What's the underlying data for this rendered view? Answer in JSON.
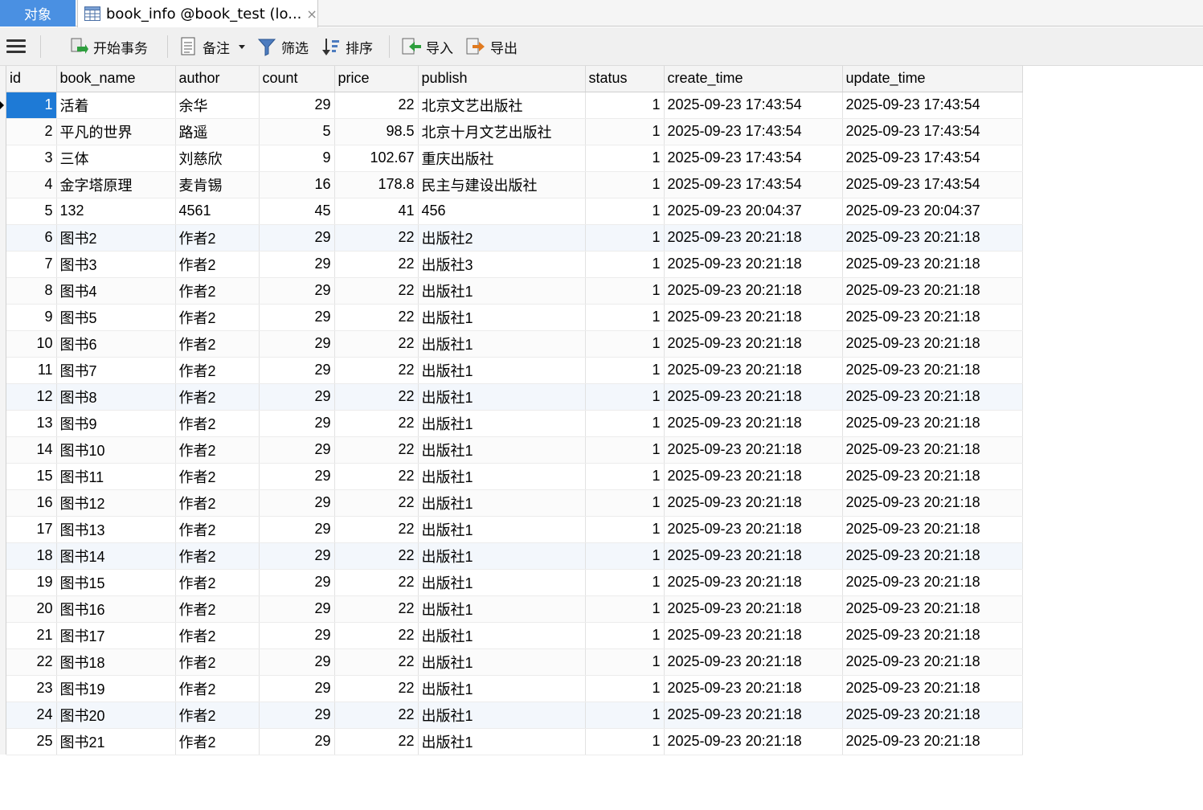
{
  "tabs": {
    "objects_label": "对象",
    "table_tab_label": "book_info @book_test (lo...",
    "close_glyph": "×"
  },
  "toolbar": {
    "begin_transaction": "开始事务",
    "notes": "备注",
    "filter": "筛选",
    "sort": "排序",
    "import": "导入",
    "export": "导出"
  },
  "grid": {
    "columns": [
      "id",
      "book_name",
      "author",
      "count",
      "price",
      "publish",
      "status",
      "create_time",
      "update_time"
    ],
    "rows": [
      [
        "1",
        "活着",
        "余华",
        "29",
        "22",
        "北京文艺出版社",
        "1",
        "2025-09-23 17:43:54",
        "2025-09-23 17:43:54"
      ],
      [
        "2",
        "平凡的世界",
        "路遥",
        "5",
        "98.5",
        "北京十月文艺出版社",
        "1",
        "2025-09-23 17:43:54",
        "2025-09-23 17:43:54"
      ],
      [
        "3",
        "三体",
        "刘慈欣",
        "9",
        "102.67",
        "重庆出版社",
        "1",
        "2025-09-23 17:43:54",
        "2025-09-23 17:43:54"
      ],
      [
        "4",
        "金字塔原理",
        "麦肯锡",
        "16",
        "178.8",
        "民主与建设出版社",
        "1",
        "2025-09-23 17:43:54",
        "2025-09-23 17:43:54"
      ],
      [
        "5",
        "132",
        "4561",
        "45",
        "41",
        "456",
        "1",
        "2025-09-23 20:04:37",
        "2025-09-23 20:04:37"
      ],
      [
        "6",
        "图书2",
        "作者2",
        "29",
        "22",
        "出版社2",
        "1",
        "2025-09-23 20:21:18",
        "2025-09-23 20:21:18"
      ],
      [
        "7",
        "图书3",
        "作者2",
        "29",
        "22",
        "出版社3",
        "1",
        "2025-09-23 20:21:18",
        "2025-09-23 20:21:18"
      ],
      [
        "8",
        "图书4",
        "作者2",
        "29",
        "22",
        "出版社1",
        "1",
        "2025-09-23 20:21:18",
        "2025-09-23 20:21:18"
      ],
      [
        "9",
        "图书5",
        "作者2",
        "29",
        "22",
        "出版社1",
        "1",
        "2025-09-23 20:21:18",
        "2025-09-23 20:21:18"
      ],
      [
        "10",
        "图书6",
        "作者2",
        "29",
        "22",
        "出版社1",
        "1",
        "2025-09-23 20:21:18",
        "2025-09-23 20:21:18"
      ],
      [
        "11",
        "图书7",
        "作者2",
        "29",
        "22",
        "出版社1",
        "1",
        "2025-09-23 20:21:18",
        "2025-09-23 20:21:18"
      ],
      [
        "12",
        "图书8",
        "作者2",
        "29",
        "22",
        "出版社1",
        "1",
        "2025-09-23 20:21:18",
        "2025-09-23 20:21:18"
      ],
      [
        "13",
        "图书9",
        "作者2",
        "29",
        "22",
        "出版社1",
        "1",
        "2025-09-23 20:21:18",
        "2025-09-23 20:21:18"
      ],
      [
        "14",
        "图书10",
        "作者2",
        "29",
        "22",
        "出版社1",
        "1",
        "2025-09-23 20:21:18",
        "2025-09-23 20:21:18"
      ],
      [
        "15",
        "图书11",
        "作者2",
        "29",
        "22",
        "出版社1",
        "1",
        "2025-09-23 20:21:18",
        "2025-09-23 20:21:18"
      ],
      [
        "16",
        "图书12",
        "作者2",
        "29",
        "22",
        "出版社1",
        "1",
        "2025-09-23 20:21:18",
        "2025-09-23 20:21:18"
      ],
      [
        "17",
        "图书13",
        "作者2",
        "29",
        "22",
        "出版社1",
        "1",
        "2025-09-23 20:21:18",
        "2025-09-23 20:21:18"
      ],
      [
        "18",
        "图书14",
        "作者2",
        "29",
        "22",
        "出版社1",
        "1",
        "2025-09-23 20:21:18",
        "2025-09-23 20:21:18"
      ],
      [
        "19",
        "图书15",
        "作者2",
        "29",
        "22",
        "出版社1",
        "1",
        "2025-09-23 20:21:18",
        "2025-09-23 20:21:18"
      ],
      [
        "20",
        "图书16",
        "作者2",
        "29",
        "22",
        "出版社1",
        "1",
        "2025-09-23 20:21:18",
        "2025-09-23 20:21:18"
      ],
      [
        "21",
        "图书17",
        "作者2",
        "29",
        "22",
        "出版社1",
        "1",
        "2025-09-23 20:21:18",
        "2025-09-23 20:21:18"
      ],
      [
        "22",
        "图书18",
        "作者2",
        "29",
        "22",
        "出版社1",
        "1",
        "2025-09-23 20:21:18",
        "2025-09-23 20:21:18"
      ],
      [
        "23",
        "图书19",
        "作者2",
        "29",
        "22",
        "出版社1",
        "1",
        "2025-09-23 20:21:18",
        "2025-09-23 20:21:18"
      ],
      [
        "24",
        "图书20",
        "作者2",
        "29",
        "22",
        "出版社1",
        "1",
        "2025-09-23 20:21:18",
        "2025-09-23 20:21:18"
      ],
      [
        "25",
        "图书21",
        "作者2",
        "29",
        "22",
        "出版社1",
        "1",
        "2025-09-23 20:21:18",
        "2025-09-23 20:21:18"
      ]
    ]
  },
  "colors": {
    "accent": "#1e7ad6",
    "tab_objects_bg": "#4a90e2",
    "toolbar_bg": "#f0f0f0"
  },
  "icons": {
    "menu": "hamburger-menu-icon",
    "table_tab": "table-grid-icon",
    "begin_transaction": "transaction-icon",
    "notes": "note-document-icon",
    "filter": "funnel-filter-icon",
    "sort": "sort-icon",
    "import": "import-icon",
    "export": "export-icon"
  }
}
